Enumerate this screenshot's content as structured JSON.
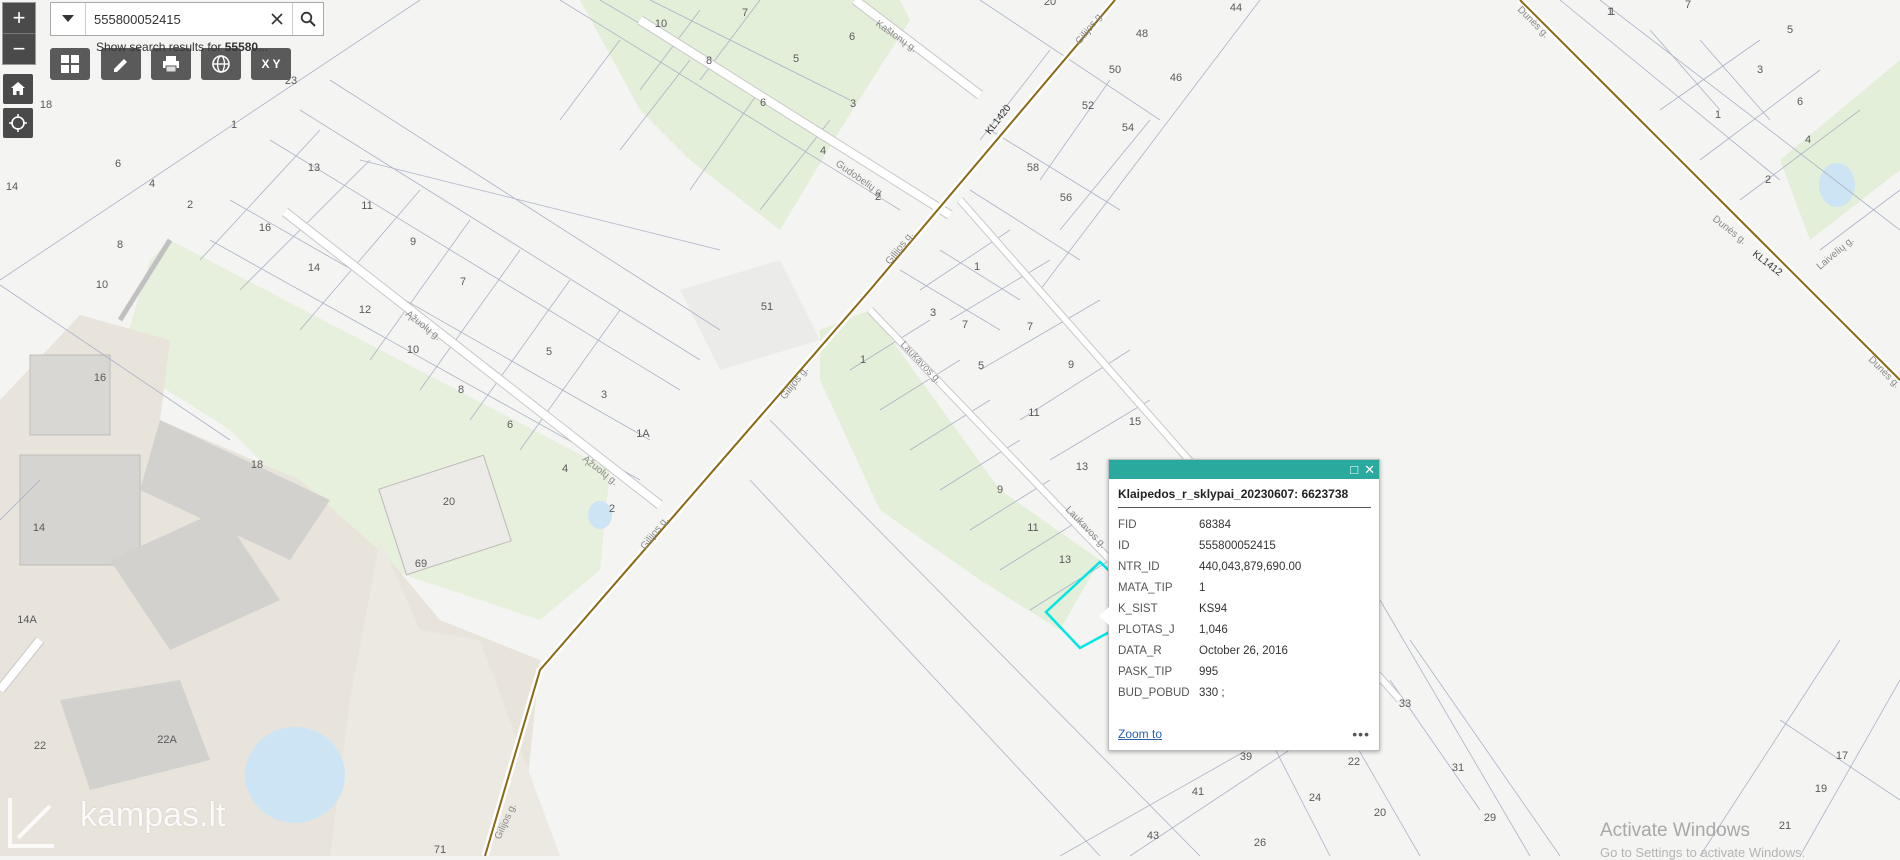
{
  "search": {
    "value": "555800052415",
    "suggest_prefix": "Show search results for ",
    "suggest_bold": "55580",
    "suggest_suffix": "..."
  },
  "zoom": {
    "in_label": "+",
    "out_label": "−"
  },
  "toolbar": {
    "coord_label": "X Y"
  },
  "icons": {
    "dropdown": "chevron-down-icon",
    "clear": "close-icon",
    "search": "search-icon",
    "home": "home-icon",
    "locate": "locate-icon",
    "basemap": "grid-icon",
    "measure": "pencil-icon",
    "print": "printer-icon",
    "layers": "globe-icon"
  },
  "popup": {
    "title": "Klaipedos_r_sklypai_20230607: 6623738",
    "fields": [
      {
        "key": "FID",
        "value": "68384"
      },
      {
        "key": "ID",
        "value": "555800052415"
      },
      {
        "key": "NTR_ID",
        "value": "440,043,879,690.00"
      },
      {
        "key": "MATA_TIP",
        "value": "1"
      },
      {
        "key": "K_SIST",
        "value": "KS94"
      },
      {
        "key": "PLOTAS_J",
        "value": "1,046"
      },
      {
        "key": "DATA_R",
        "value": "October 26, 2016"
      },
      {
        "key": "PASK_TIP",
        "value": "995"
      },
      {
        "key": "BUD_POBUD",
        "value": "330 ;"
      }
    ],
    "zoom_to": "Zoom to",
    "more": "•••"
  },
  "streets": {
    "gilijos": "Gilijos g.",
    "kastonu": "Kaštonų g.",
    "gudobeliu": "Gudobelių g.",
    "azuolu": "Ąžuolų g.",
    "laukavos": "Laukavos g.",
    "dunes": "Dunės g.",
    "laiveliu": "Laivelių g.",
    "kl1420": "KL1420",
    "kl1412": "KL1412"
  },
  "plots": [
    "1",
    "2",
    "3",
    "4",
    "5",
    "6",
    "7",
    "8",
    "9",
    "10",
    "11",
    "12",
    "13",
    "14",
    "14A",
    "15",
    "16",
    "17",
    "18",
    "19",
    "20",
    "21",
    "22",
    "22A",
    "23",
    "24",
    "26",
    "29",
    "31",
    "33",
    "39",
    "41",
    "43",
    "44",
    "46",
    "48",
    "50",
    "51",
    "52",
    "54",
    "56",
    "58",
    "69",
    "71",
    "1A"
  ],
  "branding": {
    "logo": "kampas.lt"
  },
  "watermark": {
    "line1": "Activate Windows",
    "line2": "Go to Settings to activate Windows."
  },
  "colors": {
    "accent": "#2aa99e",
    "highlight": "#00e5e5",
    "road": "#8b6914",
    "green": "#e3efd8"
  }
}
